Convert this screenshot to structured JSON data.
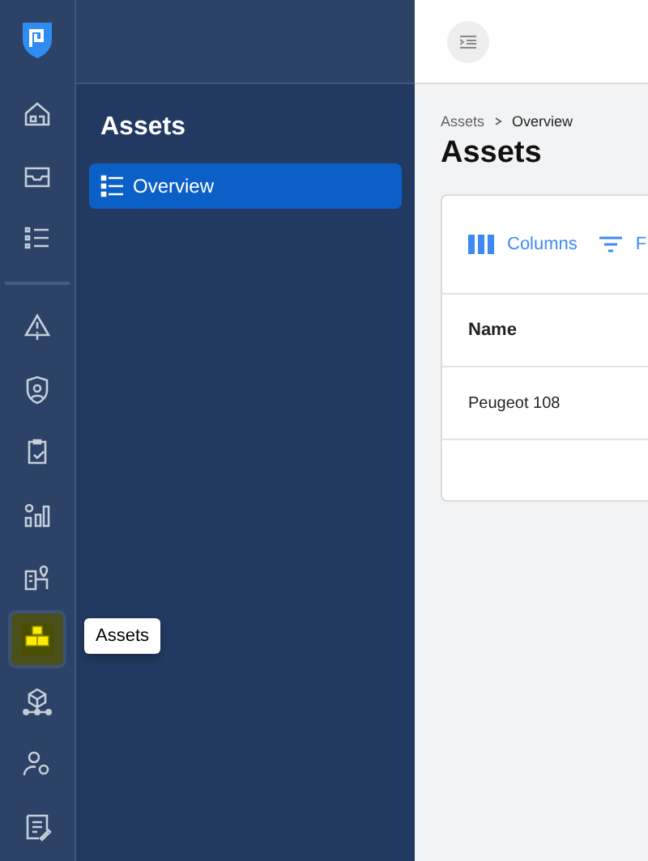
{
  "rail": {
    "top_items": [
      {
        "kind": "home",
        "selected": false
      },
      {
        "kind": "inbox",
        "selected": false
      },
      {
        "kind": "list",
        "selected": false
      }
    ],
    "bottom_items": [
      {
        "kind": "alert",
        "selected": false
      },
      {
        "kind": "shield",
        "selected": false
      },
      {
        "kind": "clipboard",
        "selected": false
      },
      {
        "kind": "chart",
        "selected": false
      },
      {
        "kind": "building",
        "selected": false
      },
      {
        "kind": "boxes",
        "selected": true
      },
      {
        "kind": "network",
        "selected": false
      },
      {
        "kind": "usergear",
        "selected": false
      },
      {
        "kind": "report",
        "selected": false
      }
    ]
  },
  "tooltip": {
    "text": "Assets"
  },
  "panel": {
    "title": "Assets",
    "items": [
      {
        "label": "Overview",
        "selected": true
      }
    ]
  },
  "breadcrumb": [
    "Assets",
    "Overview"
  ],
  "page_title": "Assets",
  "toolbar": [
    {
      "kind": "columns",
      "label": "Columns"
    },
    {
      "kind": "filter",
      "label": "F"
    }
  ],
  "table": {
    "columns": [
      "Name"
    ],
    "rows": [
      [
        "Peugeot 108"
      ]
    ]
  }
}
